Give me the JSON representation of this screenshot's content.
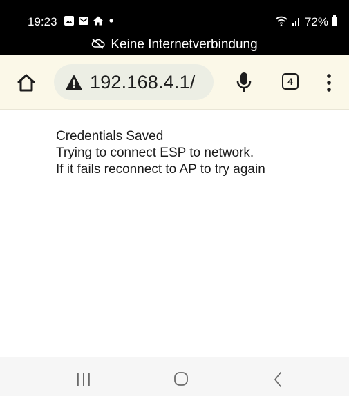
{
  "status_bar": {
    "time": "19:23",
    "battery_percent": "72%",
    "left_icons": [
      "gallery-icon",
      "message-icon",
      "home-notification-icon",
      "dot-icon"
    ],
    "right_icons": [
      "wifi-icon",
      "signal-icon",
      "battery-icon"
    ]
  },
  "offline_banner": {
    "icon": "cloud-off-icon",
    "text": "Keine Internetverbindung"
  },
  "toolbar": {
    "home_icon": "home-icon",
    "url_warning_icon": "warning-icon",
    "url": "192.168.4.1/",
    "mic_icon": "mic-icon",
    "tab_count": "4",
    "menu_icon": "more-vert-icon"
  },
  "page": {
    "lines": [
      "Credentials Saved",
      "Trying to connect ESP to network.",
      "If it fails reconnect to AP to try again"
    ]
  },
  "nav_bar": {
    "recents_icon": "recents-icon",
    "home_icon": "nav-home-icon",
    "back_icon": "back-icon"
  },
  "colors": {
    "status_bg": "#000000",
    "toolbar_bg": "#fbf8e8",
    "url_pill_bg": "#eceee4",
    "nav_bg": "#f6f6f6",
    "text": "#1b1b1b"
  }
}
